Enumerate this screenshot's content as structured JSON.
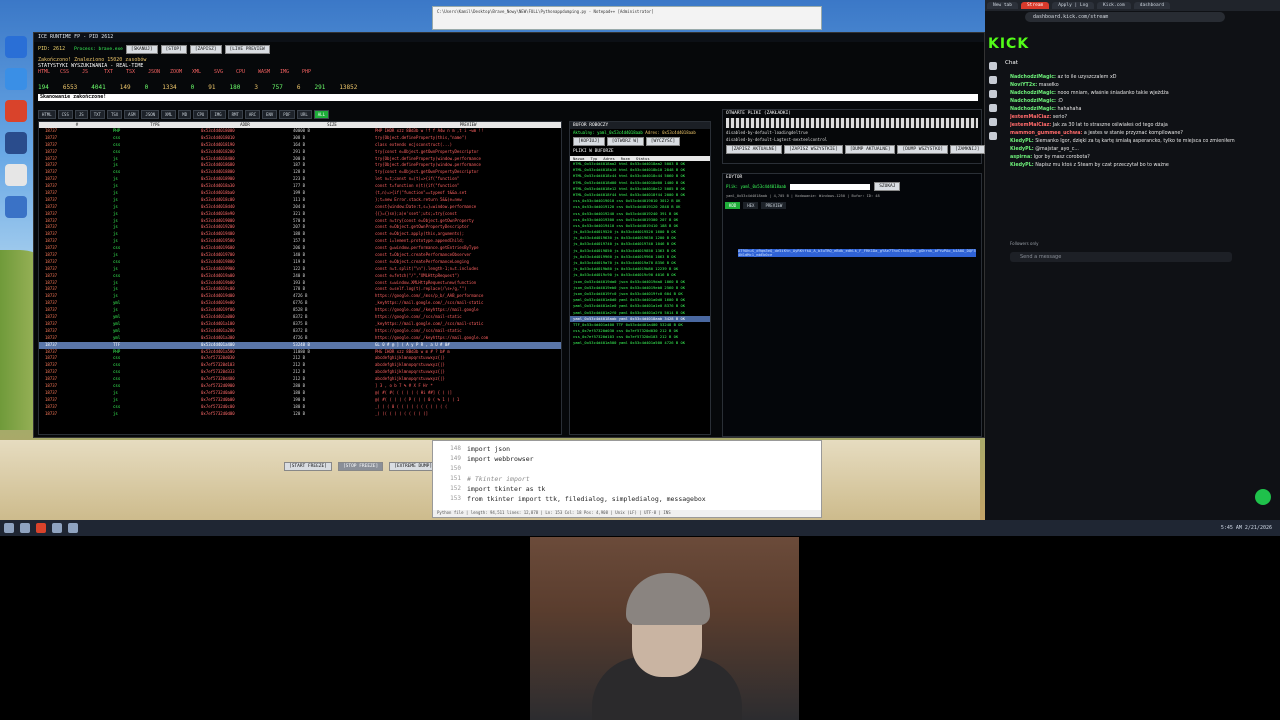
{
  "app": {
    "title": "ICE RUNTIME FP - PID 2612",
    "pid_label": "PID: 2612",
    "process_label": "Process: brave.exe",
    "buttons": [
      "[SKANUJ]",
      "[STOP]",
      "[ZAPISZ]",
      "[LIVE PREVIEW"
    ],
    "status_line": "Zakończono! Znaleziono 15020 zasobów",
    "stats_header": "STATYSTYKI WYSZUKIWANIA - REAL-TIME",
    "stat_labels": [
      "HTML",
      "CSS",
      "JS",
      "TXT",
      "TSX",
      "JSON",
      "ZOOM",
      "XML",
      "SVG",
      "CPU",
      "WASM",
      "IMG",
      "PHP"
    ],
    "stat_values": [
      "194",
      "6553",
      "4041",
      "149",
      "0",
      "1334",
      "0",
      "91",
      "180",
      "3",
      "757",
      "6",
      "291",
      "13852"
    ],
    "scan_complete": "Skanowanie zakończone!",
    "filters": [
      "HTML",
      "CSS",
      "JS",
      "TXT",
      "TSX",
      "ASM",
      "JSON",
      "XML",
      "MD",
      "CPU",
      "IMG",
      "RMT",
      "ARC",
      "ENV",
      "PDF",
      "URL",
      "ALL"
    ],
    "table_headers": [
      "#",
      "TYPE",
      "ADDR",
      "SIZE",
      "PREVIEW"
    ],
    "table_rows": [
      [
        "18737",
        "PHP",
        "0x53c4d4018000",
        "40000 B",
        "PHP IHDR xzz 8Bd3b w !f f A4w n m ,t i ~wm !!"
      ],
      [
        "18737",
        "css",
        "0x53c4d4018010",
        "308 B",
        "try{Object.defineProperty(this,\"name\")"
      ],
      [
        "18737",
        "css",
        "0x53c4d4018190",
        "164 B",
        "class extends ecjsconstruct(...)"
      ],
      [
        "18737",
        "css",
        "0x53c4d4018200",
        "291 B",
        "try{const e=Object.getOwnPropertyDescriptor"
      ],
      [
        "18737",
        "js",
        "0x53c4d4018400",
        "200 B",
        "try{Object.defineProperty(window.performance"
      ],
      [
        "18737",
        "js",
        "0x53c4d4018680",
        "187 B",
        "try{Object.defineProperty(window.performance"
      ],
      [
        "18737",
        "css",
        "0x53c4d4018800",
        "128 B",
        "try{const e=Object.getOwnPropertyDescriptor"
      ],
      [
        "18737",
        "js",
        "0x53c4d4018900",
        "223 B",
        "let n=t;const n=(t)=>{if(\"function\""
      ],
      [
        "18737",
        "js",
        "0x53c4d4018a30",
        "177 B",
        "const t=function n(t){if(\"function\""
      ],
      [
        "18737",
        "js",
        "0x53c4d4018ba0",
        "199 B",
        "(t,n)=>{if(\"function\"==typeof t&&a.set"
      ],
      [
        "18737",
        "js",
        "0x53c4d4018c00",
        "111 B",
        "};t=new Error.stack.return 5&&(e=new"
      ],
      [
        "18737",
        "js",
        "0x53c4d4018d40",
        "204 B",
        "const{window:Date:t,s=}=window.performance"
      ],
      [
        "18737",
        "js",
        "0x53c4d4018e90",
        "321 B",
        "{{}={}sn};a)e'sset';uts;=try{const"
      ],
      [
        "18737",
        "js",
        "0x53c4d4019000",
        "570 B",
        "const n=try{const e=Object.getOwnProperty"
      ],
      [
        "18737",
        "js",
        "0x53c4d4019200",
        "207 B",
        "const e=Object.getOwnPropertyDescriptor"
      ],
      [
        "18737",
        "js",
        "0x53c4d4019400",
        "188 B",
        "const e=Object.apply(this,arguments);"
      ],
      [
        "18737",
        "js",
        "0x53c4d4019500",
        "157 B",
        "const i=lement.prototype.appendChild;"
      ],
      [
        "18737",
        "css",
        "0x53c4d4019600",
        "206 B",
        "const g=window.performance.getEntriesByType"
      ],
      [
        "18737",
        "js",
        "0x53c4d4019700",
        "140 B",
        "const t=Object.createPerformanceObserver"
      ],
      [
        "18737",
        "css",
        "0x53c4d4019800",
        "119 B",
        "const e=Object.createPerformanceLonging"
      ],
      [
        "18737",
        "js",
        "0x53c4d4019900",
        "122 B",
        "const n=t.split(\"\\n\").length-1;n=t.includes"
      ],
      [
        "18737",
        "css",
        "0x53c4d4019a00",
        "240 B",
        "const e=fetch(\"/\",\"XMLHttpRequest\")"
      ],
      [
        "18737",
        "js",
        "0x53c4d4019b00",
        "193 B",
        "const s=window.XMLHttpRequest=new(function"
      ],
      [
        "18737",
        "js",
        "0x53c4d4019c00",
        "178 B",
        "const o=self.log(t).replace(/\\s+/g,\"\")"
      ],
      [
        "18737",
        "js",
        "0x53c4d4019d00",
        "4726 B",
        "https://google.com/_/mss/p_b/_AAB_performance"
      ],
      [
        "18737",
        "yml",
        "0x53c4d4019e00",
        "6776 B",
        "_keyhttps://mail.google.com/_/scs/mail-static"
      ],
      [
        "18737",
        "js",
        "0x53c4d4019f00",
        "8528 B",
        "https://google.com/_/keyhttps://mail.google"
      ],
      [
        "18737",
        "yml",
        "0x53c4d401a000",
        "8372 B",
        "https://google.com/_/scs/mail-static"
      ],
      [
        "18737",
        "yml",
        "0x53c4d401a100",
        "8375 B",
        "_keyhttps://mail.google.com/_/scs/mail-static"
      ],
      [
        "18737",
        "yml",
        "0x53c4d401a200",
        "8372 B",
        "https://google.com/_/scs/mail-static"
      ],
      [
        "18737",
        "yml",
        "0x53c4d401a300",
        "4726 B",
        "https://google.com/_/keyhttps://mail.google.com"
      ],
      [
        "18737",
        "TTF",
        "0x53c4d401a400",
        "53248 B",
        "GL 0 # @ ] ( A y P R , a U # 0#"
      ],
      [
        "18737",
        "PHP",
        "0x53c4d401a500",
        "11080 B",
        "PHG IHDR xzz 8Bd3b w m # ? b# m"
      ],
      [
        "18737",
        "css",
        "0x7ef57320d030",
        "212 B",
        "abcdefghijklmnopqrstuvwxyz{|}"
      ],
      [
        "18737",
        "css",
        "0x7ef57320d103",
        "212 B",
        "abcdefghijklmnopqrstuvwxyz{|}"
      ],
      [
        "18737",
        "css",
        "0x7ef57320d333",
        "212 B",
        "abcdefghijklmnopqrstuvwxyz{|}"
      ],
      [
        "18737",
        "css",
        "0x7ef57320d480",
        "212 B",
        "abcdefghijklmnopqrstuvwxyz{|}"
      ],
      [
        "18737",
        "css",
        "0x7ef5732d0900",
        "280 B",
        "] 3 , o b 7 % # X F Hr *"
      ],
      [
        "18737",
        "js",
        "0x7ef5732d0a00",
        "180 B",
        "@( #( #( ( ( ( ( ( Hi ##] { ( (]"
      ],
      [
        "18737",
        "js",
        "0x7ef5732d0b00",
        "190 B",
        "@( #( ( ( ( ( P ( ( ( 0 ( % 1 ( ( 1"
      ],
      [
        "18737",
        "css",
        "0x7ef5732d0c00",
        "180 B",
        "_( ( ( 0 ( ( ( ( ( ( ( ( ( ( ("
      ],
      [
        "18737",
        "js",
        "0x7ef5732d0d00",
        "120 B",
        "_( (( ( ( ( ( ( ( ( (]"
      ]
    ],
    "buffer_title": "BUFOR ROBOCZY",
    "buffer_active": "Aktualny: yaml_0x53c4d4018aab",
    "buffer_addr": "Adres: 0x53c4d4018aab",
    "buffer_buttons": [
      "[KOPIUJ]",
      "[OTWÓRZ W]",
      "[WYCZYŚĆ]"
    ],
    "buffer_files_title": "PLIKI W BUFORZE",
    "buffer_headers": [
      "Nazwa",
      "Typ",
      "Adres",
      "Rozm",
      "Status"
    ],
    "buffer_rows": [
      "HTML_0x53c4d4018aa2 html 0x53c4d4018aa2 5003 B OK",
      "HTML_0x53c4d4018b10 html 0x53c4d4018b10 2848 B OK",
      "HTML_0x53c4d4018c44 html 0x53c4d4018c44 5060 B OK",
      "HTML_0x53c4d4018d00 html 0x53c4d4018d00 1400 B OK",
      "HTML_0x53c4d4018e12 html 0x53c4d4018e12 5085 B OK",
      "HTML_0x53c4d4018f44 html 0x53c4d4018f44 2000 B OK",
      "css_0x53c4d4019010 css 0x53c4d4019010 3012 B OK",
      "css_0x53c4d4019120 css 0x53c4d4019120 2848 B OK",
      "css_0x53c4d4019240 css 0x53c4d4019240 391 B OK",
      "css_0x53c4d4019300 css 0x53c4d4019300 207 B OK",
      "css_0x53c4d4019410 css 0x53c4d4019410 188 B OK",
      "js_0x53c4d4019520 js 0x53c4d4019520 1600 B OK",
      "js_0x53c4d4019630 js 0x53c4d4019630 1200 B OK",
      "js_0x53c4d4019740 js 0x53c4d4019740 1046 B OK",
      "js_0x53c4d4019850 js 0x53c4d4019850 1363 B OK",
      "js_0x53c4d4019960 js 0x53c4d4019960 1063 B OK",
      "js_0x53c4d4019a70 js 0x53c4d4019a70 8356 B OK",
      "js_0x53c4d4019b80 js 0x53c4d4019b80 12239 B OK",
      "js_0x53c4d4019c90 js 0x53c4d4019c90 4016 B OK",
      "json_0x53c4d4019da0 json 0x53c4d4019da0 1060 B OK",
      "json_0x53c4d4019eb0 json 0x53c4d4019eb0 2560 B OK",
      "json_0x53c4d4019fc0 json 0x53c4d4019fc0 604 B OK",
      "yaml_0x53c4d401a0d0 yaml 0x53c4d401a0d0 1600 B OK",
      "yaml_0x53c4d401a1e0 yaml 0x53c4d401a1e0 8376 B OK",
      "yaml_0x53c4d401a2f0 yaml 0x53c4d401a2f0 5014 B OK",
      "yaml_0x53c4d4018aab yaml 0x53c4d4018aab 3428 B OK",
      "TTF_0x53c4d401a400 TTF 0x53c4d401a400 53248 B OK",
      "css_0x7ef57320d030 css 0x7ef57320d030 212 B OK",
      "css_0x7ef57320d103 css 0x7ef57320d103 212 B OK",
      "yaml_0x53c4d401a500 yaml 0x53c4d401a500 4726 B OK"
    ],
    "open_files_title": "OTWARTE PLIKI (ZAKŁADKI)",
    "open_files_lines": [
      "disabled-by-default-loadingdeltrue",
      "disabled-by-default-Lagtest-mexteelcontrol"
    ],
    "open_files_buttons": [
      "[ZAPISZ AKTUALNE]",
      "[ZAPISZ WSZYSTKIE]",
      "[DUMP AKTUALNE]",
      "[DUMP WSZYSTKO]",
      "[ZAMKNIJ]"
    ],
    "editor_title": "EDYTOR",
    "editor_file": "Plik: yaml_0x53c4d4018aab",
    "editor_search": "SZUKAJ",
    "editor_meta": "yaml_0x53c4d4018aab | 4,705 B | Kodowanie: Windows-1250 | Bufor: ID: 48",
    "editor_tabs": [
      "KOD",
      "HEX",
      "PREVIEW"
    ],
    "editor_text": "AT9OhuS_d9qm3eQ_de5iKtn_AyRKtfkA_A_b3uTRQ_eBdk_edhLk_F_FRK1Da_gYAe7ThvClhckgOv_gGhrnk_bFYwPAo_k4A0O_DQF5uZ1XLdbIEcrE-4N1dMc1_mbEb0ce",
    "bottom_buttons": [
      "[START FREEZE]",
      "[STOP FREEZE]",
      "[EXTREME DUMP]"
    ]
  },
  "python_editor": {
    "title": "C:\\Users\\Kamil\\Desktop\\Brave_Nowy\\NEW\\FULL\\Pythonappdumping.py - Notepad++ [Administrator]",
    "line_numbers": [
      "148",
      "149",
      "150",
      "151",
      "152",
      "153"
    ],
    "lines": [
      "import json",
      "import webbrowser",
      "",
      "# Tkinter import",
      "import tkinter as tk",
      "from tkinter import ttk, filedialog, simpledialog, messagebox"
    ],
    "status": "Python file | length: 94,511 lines: 12,878 | Ln: 153 Col: 18 Pos: 4,908 | Unix (LF) | UTF-8 | INS"
  },
  "browser": {
    "tabs": [
      "New tab",
      "Stream",
      "Apply | Log",
      "Kick.com",
      "dashboard"
    ],
    "url": "dashboard.kick.com/stream",
    "logo": "KICK",
    "chat_title": "Chat",
    "chat_messages": [
      {
        "user": "NadchodziMagic:",
        "text": "az to ile uzyszczalem xD"
      },
      {
        "user": "NoviYT2x:",
        "text": "masełko"
      },
      {
        "user": "NadchodziMagic:",
        "text": "nooo mniam, właśnie śniadanko takie wjeżdża"
      },
      {
        "user": "NadchodziMagic:",
        "text": ":D"
      },
      {
        "user": "NadchodziMagic:",
        "text": "hahahaha"
      },
      {
        "user": "JestemMalCiaz:",
        "text": "serio?"
      },
      {
        "user": "JestemMalCiaz:",
        "text": "Jak za 30 lat to straszne oślwiałeś od tego dżaja"
      },
      {
        "user": "mammon_gummee_uchwa:",
        "text": "a jestes w stanie przyznać kompilowane?"
      },
      {
        "user": "KiedyPL:",
        "text": "Siemanko Igor, dzięki za tą kartę śmiałą asperancko, tylko te miejsca co zmieniłem"
      },
      {
        "user": "KiedyPL:",
        "text": "@majstar_ayo_c..."
      },
      {
        "user": "aspirna:",
        "text": "Igor by masz corobota?"
      },
      {
        "user": "KiedyPL:",
        "text": "Napisz mu ktoś z Steam by czat przeczytał bo to ważne"
      }
    ],
    "chat_placeholder": "Send a message",
    "followers_only": "Followers only"
  },
  "taskbar": {
    "clock": "5:45 AM 2/21/2026"
  }
}
